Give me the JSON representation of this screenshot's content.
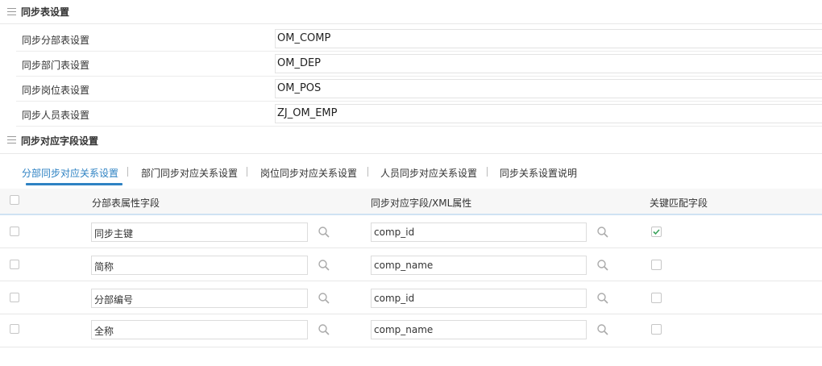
{
  "sync_tables": {
    "title": "同步表设置",
    "rows": [
      {
        "label": "同步分部表设置",
        "value": "OM_COMP"
      },
      {
        "label": "同步部门表设置",
        "value": "OM_DEP"
      },
      {
        "label": "同步岗位表设置",
        "value": "OM_POS"
      },
      {
        "label": "同步人员表设置",
        "value": "ZJ_OM_EMP"
      }
    ]
  },
  "sync_fields": {
    "title": "同步对应字段设置",
    "tabs": [
      {
        "label": "分部同步对应关系设置",
        "active": true
      },
      {
        "label": "部门同步对应关系设置",
        "active": false
      },
      {
        "label": "岗位同步对应关系设置",
        "active": false
      },
      {
        "label": "人员同步对应关系设置",
        "active": false
      },
      {
        "label": "同步关系设置说明",
        "active": false
      }
    ],
    "columns": {
      "field": "分部表属性字段",
      "xml": "同步对应字段/XML属性",
      "key": "关键匹配字段"
    },
    "rows": [
      {
        "field": "同步主键",
        "xml": "comp_id",
        "key_checked": true
      },
      {
        "field": "简称",
        "xml": "comp_name",
        "key_checked": false
      },
      {
        "field": "分部编号",
        "xml": "comp_id",
        "key_checked": false
      },
      {
        "field": "全称",
        "xml": "comp_name",
        "key_checked": false
      }
    ]
  },
  "icons": {
    "section": "menu-icon",
    "lookup": "search-icon",
    "check": "checkmark-icon"
  },
  "colors": {
    "accent": "#2e82c3",
    "check": "#3aa35c"
  }
}
